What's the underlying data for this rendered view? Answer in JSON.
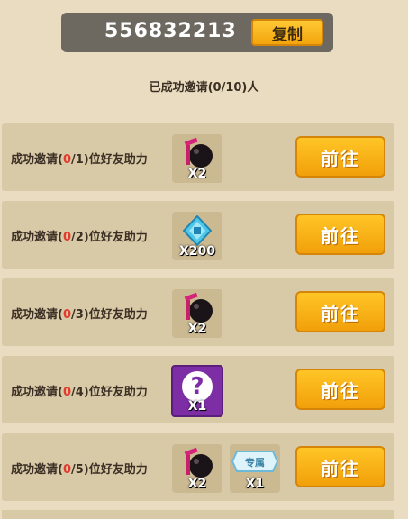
{
  "invite_code": "556832213",
  "copy_label": "复制",
  "invite_status": "已成功邀请(0/10)人",
  "colors": {
    "accent": "#f3a40d",
    "done_count": "#e23b2e",
    "panel": "#d8c9a7"
  },
  "tasks": [
    {
      "prefix": "成功邀请(",
      "done": "0",
      "suffix": "/1)位好友助力",
      "button": "前往",
      "rewards": [
        {
          "icon": "bomb-icon",
          "qty": "X2"
        }
      ]
    },
    {
      "prefix": "成功邀请(",
      "done": "0",
      "suffix": "/2)位好友助力",
      "button": "前往",
      "rewards": [
        {
          "icon": "multiplier-diamond-icon",
          "qty": "X200"
        }
      ]
    },
    {
      "prefix": "成功邀请(",
      "done": "0",
      "suffix": "/3)位好友助力",
      "button": "前往",
      "rewards": [
        {
          "icon": "bomb-icon",
          "qty": "X2"
        }
      ]
    },
    {
      "prefix": "成功邀请(",
      "done": "0",
      "suffix": "/4)位好友助力",
      "button": "前往",
      "rewards": [
        {
          "icon": "mystery-box-icon",
          "qty": "X1"
        }
      ]
    },
    {
      "prefix": "成功邀请(",
      "done": "0",
      "suffix": "/5)位好友助力",
      "button": "前往",
      "rewards": [
        {
          "icon": "bomb-icon",
          "qty": "X2"
        },
        {
          "icon": "exclusive-badge-icon",
          "qty": "X1",
          "badge": "专属"
        }
      ]
    }
  ]
}
